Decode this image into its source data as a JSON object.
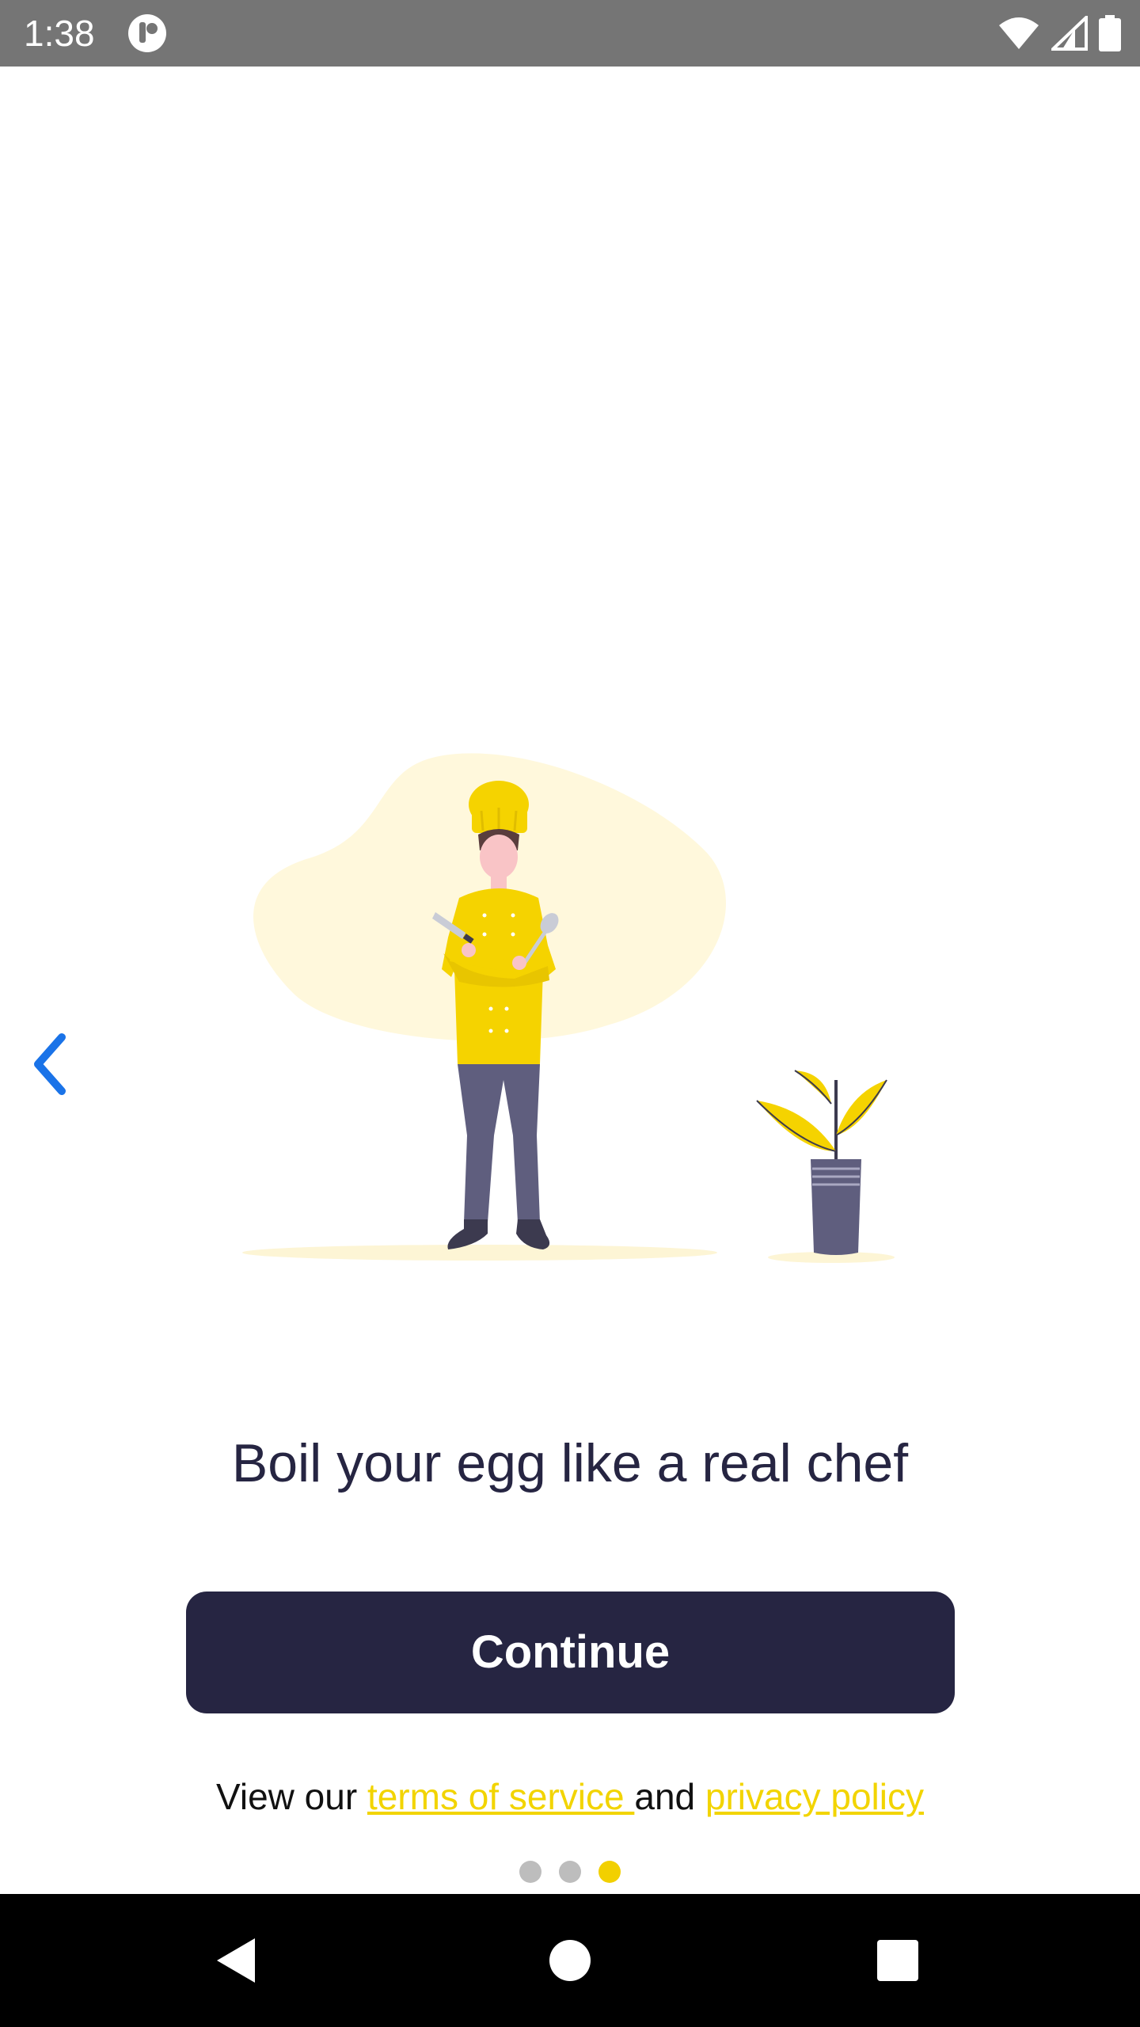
{
  "status_bar": {
    "time": "1:38",
    "icons": [
      "app-notification-icon",
      "wifi-icon",
      "cellular-signal-icon",
      "battery-icon"
    ],
    "background": "#757575"
  },
  "onboarding": {
    "headline": "Boil your egg like a real chef",
    "continue_label": "Continue",
    "legal": {
      "prefix": "View our ",
      "terms_label": "terms of service ",
      "connector": "and ",
      "privacy_label": "privacy policy "
    },
    "pager": {
      "total": 3,
      "active_index": 2
    },
    "illustration": "chef-illustration",
    "back_icon": "chevron-left-icon"
  },
  "colors": {
    "primary": "#262542",
    "accent": "#f2d400",
    "link": "#f2d400",
    "dot_inactive": "#bdbdbd",
    "chevron": "#1a73e8"
  },
  "nav_bar": {
    "buttons": [
      "back-triangle-icon",
      "home-circle-icon",
      "recents-square-icon"
    ]
  }
}
